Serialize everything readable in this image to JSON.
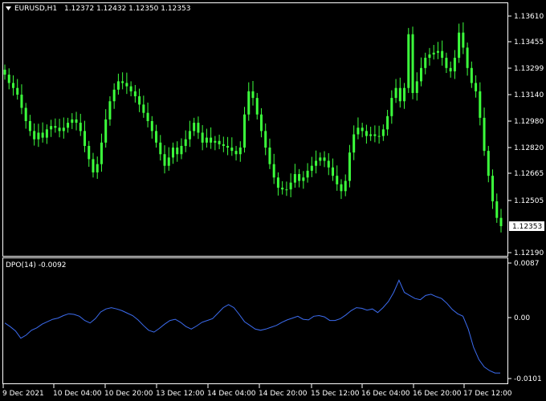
{
  "main_chart": {
    "symbol_label": "EURUSD,H1",
    "ohlc_label": "1.12372 1.12432 1.12350 1.12353",
    "price_ticks": [
      "1.13610",
      "1.13455",
      "1.13299",
      "1.13140",
      "1.12980",
      "1.12820",
      "1.12665",
      "1.12505",
      "1.12190"
    ],
    "current_price": "1.12353",
    "candle_color": "#3cff3c"
  },
  "indicator": {
    "label": "DPO(14) -0.0092",
    "ticks": [
      "0.0087",
      "0.00",
      "-0.0101"
    ],
    "line_color": "#3c6cf0"
  },
  "time_axis": {
    "labels": [
      "9 Dec 2021",
      "10 Dec 04:00",
      "10 Dec 20:00",
      "13 Dec 12:00",
      "14 Dec 04:00",
      "14 Dec 20:00",
      "15 Dec 12:00",
      "16 Dec 04:00",
      "16 Dec 20:00",
      "17 Dec 12:00"
    ]
  },
  "chart_data": [
    {
      "type": "candlestick",
      "y_ticks": [
        1.1361,
        1.13455,
        1.13299,
        1.1314,
        1.1298,
        1.1282,
        1.12665,
        1.12505,
        1.1219
      ],
      "ylim": [
        1.1216,
        1.1376
      ],
      "last_close": 1.12353,
      "close": [
        1.1326,
        1.1321,
        1.1318,
        1.1314,
        1.1306,
        1.1298,
        1.1292,
        1.1287,
        1.1291,
        1.1288,
        1.1293,
        1.1295,
        1.1294,
        1.1292,
        1.1294,
        1.1297,
        1.1299,
        1.1297,
        1.1292,
        1.1283,
        1.1275,
        1.1267,
        1.1272,
        1.1285,
        1.1299,
        1.131,
        1.1317,
        1.1322,
        1.1321,
        1.1319,
        1.1316,
        1.1313,
        1.1308,
        1.1303,
        1.1298,
        1.1292,
        1.1285,
        1.1278,
        1.1271,
        1.1276,
        1.1282,
        1.1278,
        1.1283,
        1.1287,
        1.1292,
        1.1297,
        1.1291,
        1.1285,
        1.1288,
        1.1285,
        1.1286,
        1.1284,
        1.1283,
        1.1282,
        1.128,
        1.1278,
        1.1282,
        1.1302,
        1.1316,
        1.1312,
        1.1302,
        1.1292,
        1.1282,
        1.1272,
        1.1264,
        1.1258,
        1.1257,
        1.1257,
        1.1261,
        1.1266,
        1.1262,
        1.1264,
        1.1268,
        1.1271,
        1.1274,
        1.1276,
        1.1274,
        1.127,
        1.1265,
        1.126,
        1.1256,
        1.1262,
        1.1279,
        1.129,
        1.1294,
        1.1292,
        1.1289,
        1.129,
        1.1289,
        1.1289,
        1.1293,
        1.1301,
        1.1312,
        1.1318,
        1.131,
        1.1318,
        1.135,
        1.1315,
        1.1322,
        1.133,
        1.1336,
        1.1338,
        1.1339,
        1.134,
        1.1336,
        1.133,
        1.1328,
        1.1336,
        1.1351,
        1.1342,
        1.133,
        1.1321,
        1.1316,
        1.13,
        1.128,
        1.1265,
        1.125,
        1.124,
        1.1235
      ]
    },
    {
      "type": "line",
      "name": "DPO(14)",
      "y_ticks": [
        0.0087,
        0.0,
        -0.0101
      ],
      "ylim": [
        -0.0105,
        0.0092
      ],
      "last_value": -0.0092,
      "values": [
        -0.001,
        -0.0016,
        -0.0023,
        -0.0035,
        -0.003,
        -0.0022,
        -0.0018,
        -0.0012,
        -0.0008,
        -0.0004,
        -0.0002,
        0.0002,
        0.0005,
        0.0004,
        0.0001,
        -0.0006,
        -0.001,
        -0.0003,
        0.0008,
        0.0013,
        0.0015,
        0.0013,
        0.001,
        0.0006,
        0.0002,
        -0.0005,
        -0.0014,
        -0.0022,
        -0.0025,
        -0.0019,
        -0.0012,
        -0.0006,
        -0.0004,
        -0.0009,
        -0.0016,
        -0.002,
        -0.0015,
        -0.0009,
        -0.0006,
        -0.0003,
        0.0006,
        0.0015,
        0.002,
        0.0015,
        0.0004,
        -0.0008,
        -0.0014,
        -0.002,
        -0.0022,
        -0.002,
        -0.0017,
        -0.0014,
        -0.0009,
        -0.0005,
        -0.0002,
        0.0001,
        -0.0004,
        -0.0005,
        0.0001,
        0.0002,
        0.0,
        -0.0006,
        -0.0006,
        -0.0003,
        0.0003,
        0.001,
        0.0015,
        0.0014,
        0.0011,
        0.0013,
        0.0007,
        0.0015,
        0.0025,
        0.004,
        0.006,
        0.004,
        0.0035,
        0.003,
        0.0028,
        0.0035,
        0.0037,
        0.0033,
        0.003,
        0.0022,
        0.0012,
        0.0005,
        0.0001,
        -0.002,
        -0.005,
        -0.007,
        -0.0082,
        -0.0088,
        -0.0092,
        -0.0092
      ]
    }
  ]
}
